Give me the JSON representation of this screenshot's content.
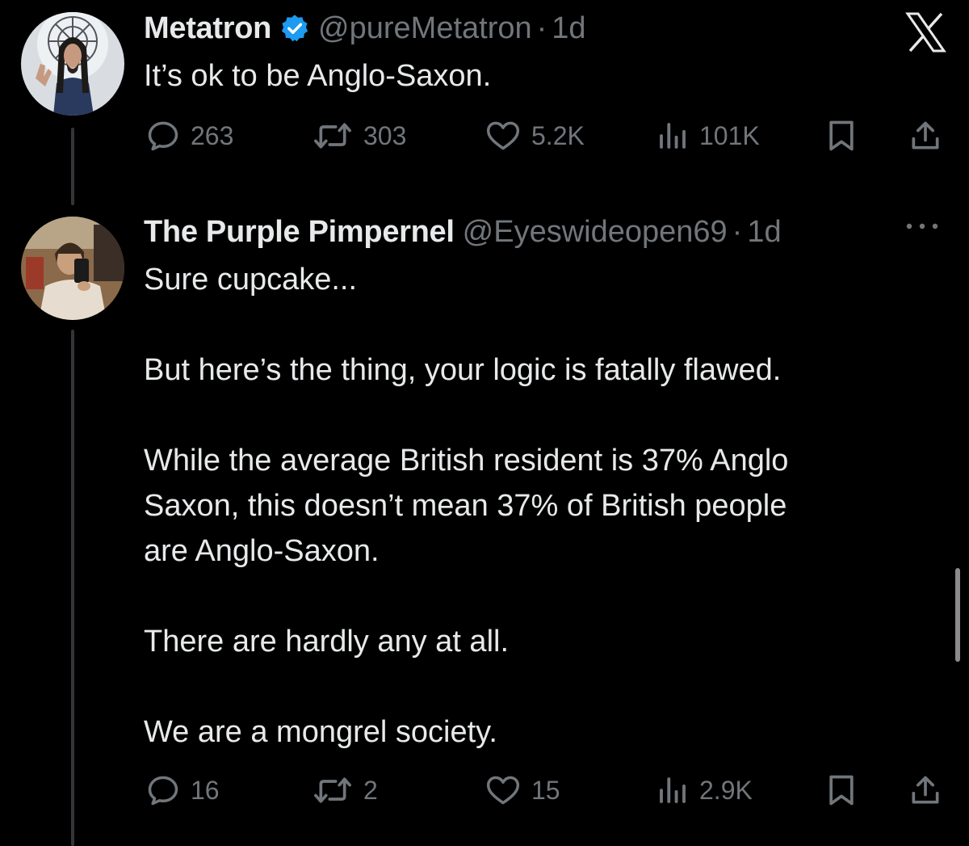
{
  "tweet1": {
    "name": "Metatron",
    "handle": "@pureMetatron",
    "separator": "·",
    "time": "1d",
    "text": "It’s ok to be Anglo-Saxon.",
    "replies": "263",
    "retweets": "303",
    "likes": "5.2K",
    "views": "101K"
  },
  "tweet2": {
    "name": "The Purple Pimpernel",
    "handle": "@Eyeswideopen69",
    "separator": "·",
    "time": "1d",
    "text": "Sure cupcake...\n\nBut here’s the thing, your logic is fatally flawed.\n\nWhile the average British resident is 37% Anglo\nSaxon, this doesn’t mean 37% of British people\nare Anglo-Saxon.\n\nThere are hardly any at all.\n\nWe are a mongrel society.",
    "replies": "16",
    "retweets": "2",
    "likes": "15",
    "views": "2.9K"
  },
  "icons": {
    "reply": "reply-icon",
    "retweet": "retweet-icon",
    "like": "heart-icon",
    "views": "views-icon",
    "bookmark": "bookmark-icon",
    "share": "share-icon",
    "more": "more-icon",
    "logo": "x-logo-icon",
    "verified": "verified-badge-icon"
  },
  "colors": {
    "background": "#000000",
    "text": "#e7e9ea",
    "secondary": "#71767b",
    "verified": "#1d9bf0"
  }
}
